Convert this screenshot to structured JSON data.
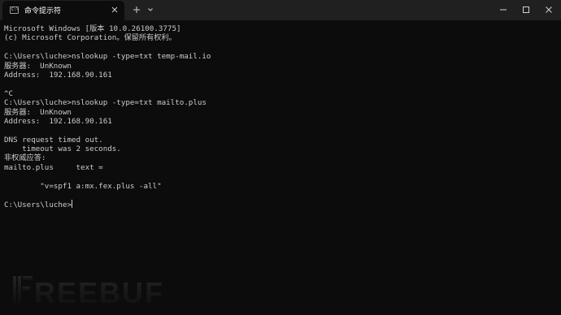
{
  "window": {
    "tab_title": "命令提示符",
    "tab_icon_text": "C:\\",
    "close_tab_icon": "close-icon",
    "new_tab_icon": "plus-icon",
    "dropdown_icon": "chevron-down-icon",
    "minimize_icon": "minimize-icon",
    "maximize_icon": "maximize-icon",
    "close_window_icon": "close-icon"
  },
  "terminal": {
    "lines": [
      "Microsoft Windows [版本 10.0.26100.3775]",
      "(c) Microsoft Corporation。保留所有权利。",
      "",
      "C:\\Users\\luche>nslookup -type=txt temp-mail.io",
      "服务器:  UnKnown",
      "Address:  192.168.90.161",
      "",
      "^C",
      "C:\\Users\\luche>nslookup -type=txt mailto.plus",
      "服务器:  UnKnown",
      "Address:  192.168.90.161",
      "",
      "DNS request timed out.",
      "    timeout was 2 seconds.",
      "非权威应答:",
      "mailto.plus     text =",
      "",
      "        \"v=spf1 a:mx.fex.plus -all\"",
      "",
      "C:\\Users\\luche>"
    ]
  },
  "watermark": {
    "text": "FREEBUF"
  },
  "colors": {
    "background": "#0c0c0c",
    "titlebar": "#202020",
    "text": "#cccccc"
  }
}
